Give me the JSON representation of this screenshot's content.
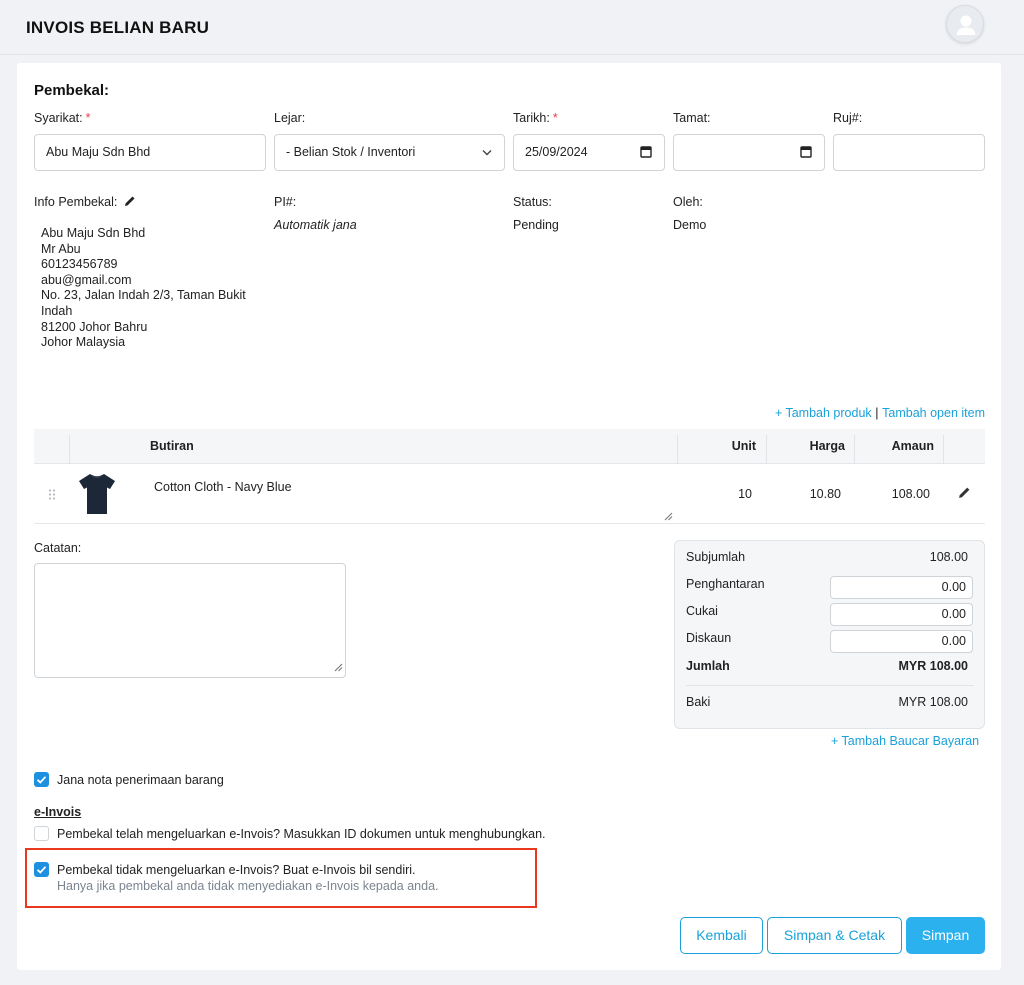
{
  "header": {
    "title": "INVOIS BELIAN BARU"
  },
  "supplier": {
    "section_title": "Pembekal:",
    "company_label": "Syarikat:",
    "company_value": "Abu Maju Sdn Bhd",
    "ledger_label": "Lejar:",
    "ledger_value": "- Belian Stok / Inventori",
    "date_label": "Tarikh:",
    "date_value": "25/09/2024",
    "due_label": "Tamat:",
    "due_value": "",
    "ref_label": "Ruj#:",
    "ref_value": "",
    "required_mark": "*",
    "info_label": "Info Pembekal:",
    "info_lines": [
      "Abu Maju Sdn Bhd",
      "Mr Abu",
      "60123456789",
      "abu@gmail.com",
      "No. 23, Jalan Indah 2/3, Taman Bukit",
      "Indah",
      "81200 Johor Bahru",
      "Johor Malaysia"
    ],
    "pi_label": "PI#:",
    "pi_value": "Automatik jana",
    "status_label": "Status:",
    "status_value": "Pending",
    "by_label": "Oleh:",
    "by_value": "Demo"
  },
  "items": {
    "add_product": "+ Tambah produk",
    "separator": "|",
    "add_open_item": "Tambah open item",
    "columns": {
      "detail": "Butiran",
      "unit": "Unit",
      "price": "Harga",
      "amount": "Amaun"
    },
    "rows": [
      {
        "description": "Cotton Cloth - Navy Blue",
        "unit": "10",
        "price": "10.80",
        "amount": "108.00",
        "color": "#1c2738"
      }
    ]
  },
  "notes": {
    "label": "Catatan:",
    "value": ""
  },
  "totals": {
    "subtotal_label": "Subjumlah",
    "subtotal_value": "108.00",
    "shipping_label": "Penghantaran",
    "shipping_value": "0.00",
    "tax_label": "Cukai",
    "tax_value": "0.00",
    "discount_label": "Diskaun",
    "discount_value": "0.00",
    "total_label": "Jumlah",
    "total_value": "MYR 108.00",
    "balance_label": "Baki",
    "balance_value": "MYR 108.00",
    "add_payment": "+ Tambah Baucar Bayaran"
  },
  "options": {
    "goods_received_label": "Jana nota penerimaan barang",
    "goods_received_checked": true,
    "einvoice_title": "e-Invois",
    "supplier_issued_label": "Pembekal telah mengeluarkan e-Invois? Masukkan ID dokumen untuk menghubungkan.",
    "supplier_issued_checked": false,
    "self_bill_label": "Pembekal tidak mengeluarkan e-Invois? Buat e-Invois bil sendiri.",
    "self_bill_hint": "Hanya jika pembekal anda tidak menyediakan e-Invois kepada anda.",
    "self_bill_checked": true
  },
  "actions": {
    "back": "Kembali",
    "save_print": "Simpan & Cetak",
    "save": "Simpan"
  },
  "colors": {
    "accent": "#1aa1d9",
    "primary_button": "#2bb2ee",
    "checkbox": "#1e90e0",
    "highlight": "#e8381e",
    "required": "#e0414a"
  }
}
